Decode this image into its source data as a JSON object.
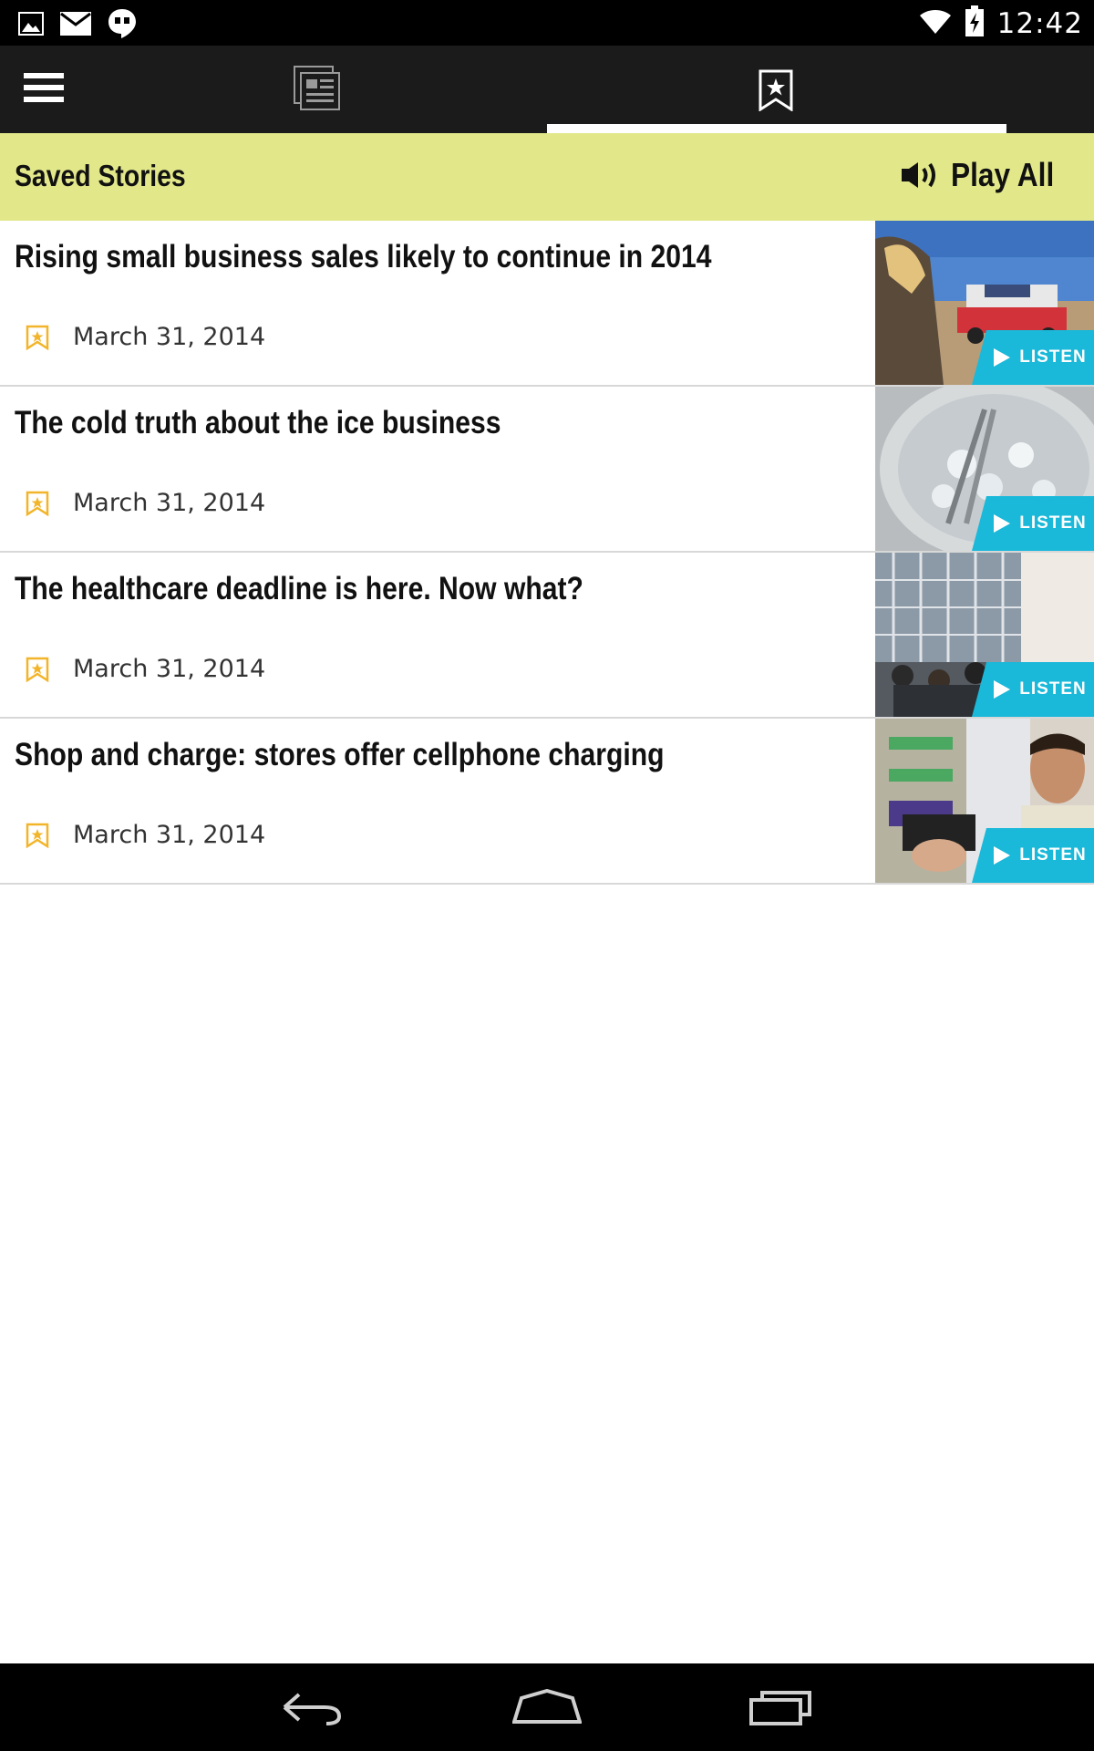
{
  "status_bar": {
    "time": "12:42",
    "icons": [
      "gallery-notification-icon",
      "gmail-notification-icon",
      "hangouts-notification-icon",
      "wifi-icon",
      "battery-charging-icon"
    ]
  },
  "top_nav": {
    "icons": [
      "hamburger-menu-icon",
      "news-icon",
      "bookmark-star-icon"
    ],
    "selected_tab": "saved"
  },
  "header": {
    "title": "Saved Stories",
    "play_all_label": "Play All",
    "background_color": "#e2e88a"
  },
  "stories": [
    {
      "title": "Rising small business sales likely to continue in 2014",
      "date": "March 31, 2014",
      "listen_label": "LISTEN",
      "thumbnail": "tow-truck-photo"
    },
    {
      "title": "The cold truth about the ice business",
      "date": "March 31, 2014",
      "listen_label": "LISTEN",
      "thumbnail": "ice-bucket-photo"
    },
    {
      "title": "The healthcare deadline is here. Now what?",
      "date": "March 31, 2014",
      "listen_label": "LISTEN",
      "thumbnail": "office-crowd-photo"
    },
    {
      "title": "Shop and charge: stores offer cellphone charging",
      "date": "March 31, 2014",
      "listen_label": "LISTEN",
      "thumbnail": "charging-kiosk-photo"
    }
  ],
  "colors": {
    "listen_accent": "#1ab8d9",
    "saved_icon": "#f2b52a",
    "nav_background": "#1b1b1b"
  },
  "system_nav": {
    "icons": [
      "back-icon",
      "home-icon",
      "recent-apps-icon"
    ]
  }
}
